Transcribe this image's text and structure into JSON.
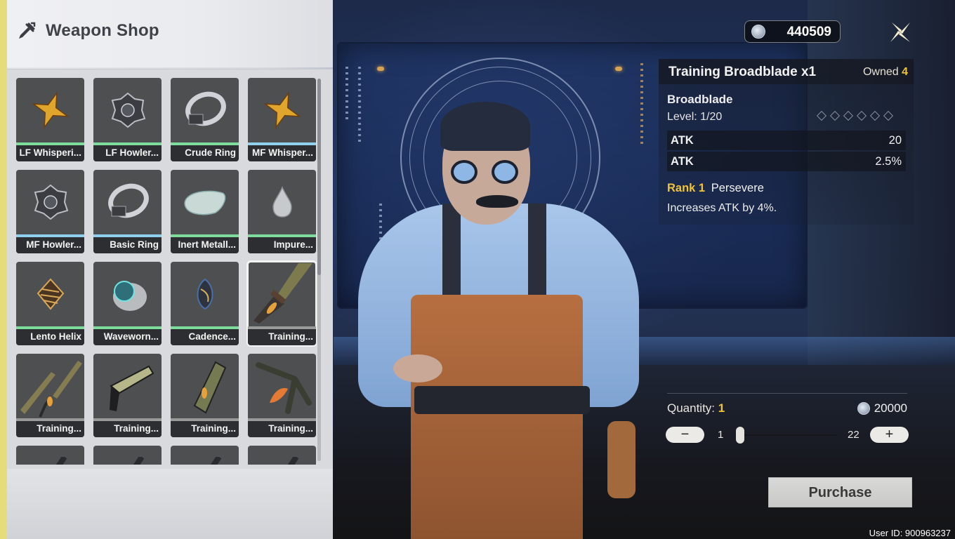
{
  "shop": {
    "title": "Weapon Shop",
    "icon": "sword-icon",
    "accent_color": "#e6dc7a",
    "items": [
      {
        "name": "LF Whisperi...",
        "rarity_color": "#7ddc9c",
        "icon": "whisperin-core-icon",
        "selected": false
      },
      {
        "name": "LF Howler...",
        "rarity_color": "#7ddc9c",
        "icon": "howler-core-icon",
        "selected": false
      },
      {
        "name": "Crude Ring",
        "rarity_color": "#7ddc9c",
        "icon": "ring-icon",
        "selected": false
      },
      {
        "name": "MF Whisper...",
        "rarity_color": "#8fd0ef",
        "icon": "whisperin-core-icon",
        "selected": false
      },
      {
        "name": "MF Howler...",
        "rarity_color": "#8fd0ef",
        "icon": "howler-core-icon",
        "selected": false
      },
      {
        "name": "Basic Ring",
        "rarity_color": "#8fd0ef",
        "icon": "ring-icon",
        "selected": false
      },
      {
        "name": "Inert Metall...",
        "rarity_color": "#7ddc9c",
        "icon": "metallic-drip-icon",
        "selected": false
      },
      {
        "name": "Impure...",
        "rarity_color": "#7ddc9c",
        "icon": "phlogiston-drop-icon",
        "selected": false
      },
      {
        "name": "Lento Helix",
        "rarity_color": "#7ddc9c",
        "icon": "helix-icon",
        "selected": false
      },
      {
        "name": "Waveworn...",
        "rarity_color": "#7ddc9c",
        "icon": "waveworn-residue-icon",
        "selected": false
      },
      {
        "name": "Cadence...",
        "rarity_color": "#7ddc9c",
        "icon": "cadence-seed-icon",
        "selected": false
      },
      {
        "name": "Training...",
        "rarity_color": "#9a9a9a",
        "icon": "broadblade-icon",
        "selected": true
      },
      {
        "name": "Training...",
        "rarity_color": "#9a9a9a",
        "icon": "sword-icon",
        "selected": false
      },
      {
        "name": "Training...",
        "rarity_color": "#9a9a9a",
        "icon": "pistol-icon",
        "selected": false
      },
      {
        "name": "Training...",
        "rarity_color": "#9a9a9a",
        "icon": "gauntlet-icon",
        "selected": false
      },
      {
        "name": "Training...",
        "rarity_color": "#9a9a9a",
        "icon": "rectifier-icon",
        "selected": false
      },
      {
        "name": "",
        "rarity_color": "#9a9a9a",
        "icon": "weapon-icon",
        "selected": false
      },
      {
        "name": "",
        "rarity_color": "#9a9a9a",
        "icon": "weapon-icon",
        "selected": false
      },
      {
        "name": "",
        "rarity_color": "#9a9a9a",
        "icon": "weapon-icon",
        "selected": false
      },
      {
        "name": "",
        "rarity_color": "#9a9a9a",
        "icon": "weapon-icon",
        "selected": false
      }
    ]
  },
  "hud": {
    "currency_amount": "440509",
    "currency_icon": "shell-credit-icon",
    "close_icon": "close-icon"
  },
  "detail": {
    "item_title": "Training Broadblade x1",
    "owned_label": "Owned",
    "owned_count": "4",
    "weapon_type": "Broadblade",
    "level": "Level: 1/20",
    "rank_slots": 6,
    "stats": [
      {
        "name": "ATK",
        "value": "20"
      },
      {
        "name": "ATK",
        "value": "2.5%"
      }
    ],
    "passive_rank": "Rank 1",
    "passive_name": "Persevere",
    "passive_desc": "Increases ATK by 4%.",
    "quantity_label": "Quantity:",
    "quantity_value": "1",
    "price": "20000",
    "slider_min": "1",
    "slider_max": "22",
    "minus_label": "−",
    "plus_label": "+",
    "purchase_label": "Purchase"
  },
  "footer": {
    "user_id": "User ID: 900963237"
  },
  "colors": {
    "highlight": "#f0c43a",
    "panel_light": "#eceef2"
  }
}
